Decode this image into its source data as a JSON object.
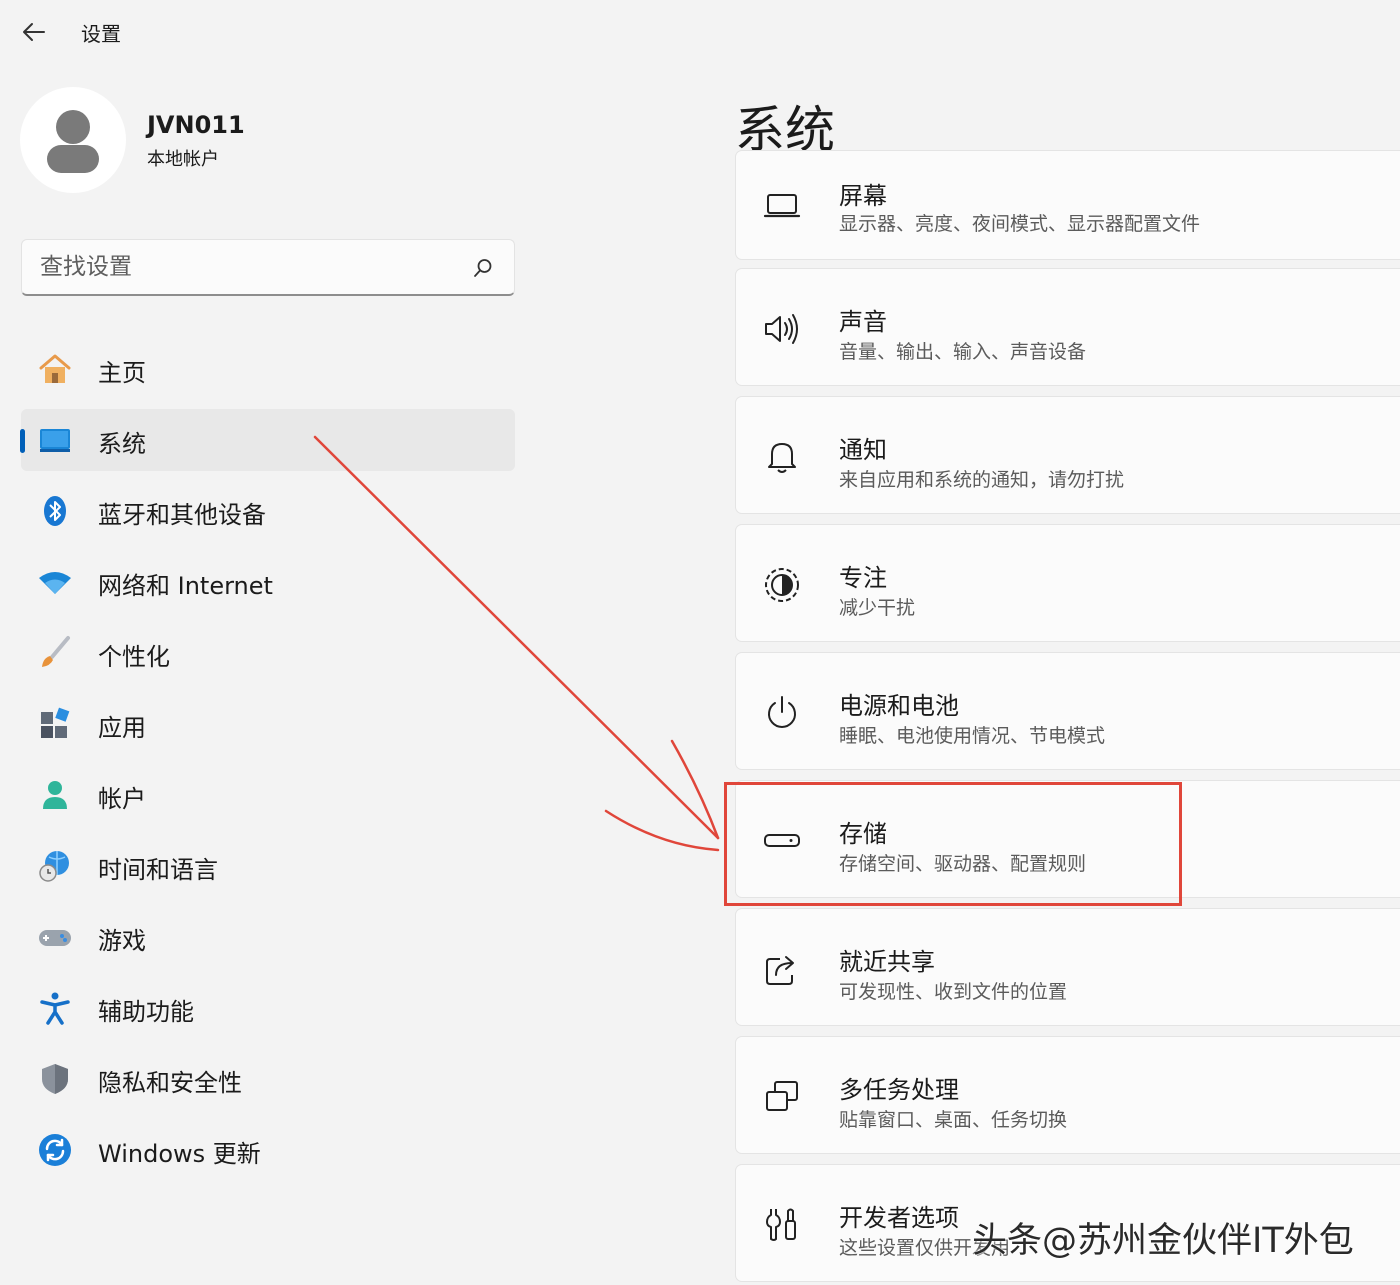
{
  "titlebar": {
    "title": "设置"
  },
  "account": {
    "name": "JVN011",
    "type": "本地帐户"
  },
  "search": {
    "placeholder": "查找设置"
  },
  "nav": {
    "items": [
      {
        "label": "主页",
        "icon": "home-icon"
      },
      {
        "label": "系统",
        "icon": "system-monitor-icon",
        "selected": true
      },
      {
        "label": "蓝牙和其他设备",
        "icon": "bluetooth-icon"
      },
      {
        "label": "网络和 Internet",
        "icon": "wifi-icon"
      },
      {
        "label": "个性化",
        "icon": "paint-brush-icon"
      },
      {
        "label": "应用",
        "icon": "apps-icon"
      },
      {
        "label": "帐户",
        "icon": "account-icon"
      },
      {
        "label": "时间和语言",
        "icon": "time-language-icon"
      },
      {
        "label": "游戏",
        "icon": "gamepad-icon"
      },
      {
        "label": "辅助功能",
        "icon": "accessibility-icon"
      },
      {
        "label": "隐私和安全性",
        "icon": "shield-icon"
      },
      {
        "label": "Windows 更新",
        "icon": "windows-update-icon"
      }
    ]
  },
  "main": {
    "title": "系统",
    "cards": [
      {
        "title": "屏幕",
        "subtitle": "显示器、亮度、夜间模式、显示器配置文件",
        "icon": "display-icon"
      },
      {
        "title": "声音",
        "subtitle": "音量、输出、输入、声音设备",
        "icon": "speaker-icon"
      },
      {
        "title": "通知",
        "subtitle": "来自应用和系统的通知，请勿打扰",
        "icon": "bell-icon"
      },
      {
        "title": "专注",
        "subtitle": "减少干扰",
        "icon": "focus-icon"
      },
      {
        "title": "电源和电池",
        "subtitle": "睡眠、电池使用情况、节电模式",
        "icon": "power-icon"
      },
      {
        "title": "存储",
        "subtitle": "存储空间、驱动器、配置规则",
        "icon": "storage-icon",
        "highlighted": true
      },
      {
        "title": "就近共享",
        "subtitle": "可发现性、收到文件的位置",
        "icon": "share-icon"
      },
      {
        "title": "多任务处理",
        "subtitle": "贴靠窗口、桌面、任务切换",
        "icon": "multitasking-icon"
      },
      {
        "title": "开发者选项",
        "subtitle": "这些设置仅供开发用",
        "icon": "developer-tools-icon"
      }
    ]
  },
  "annotation": {
    "color": "#e0463a"
  },
  "watermark": "头条@苏州金伙伴IT外包",
  "colors": {
    "accent": "#005fb8",
    "annotation": "#e0463a"
  }
}
